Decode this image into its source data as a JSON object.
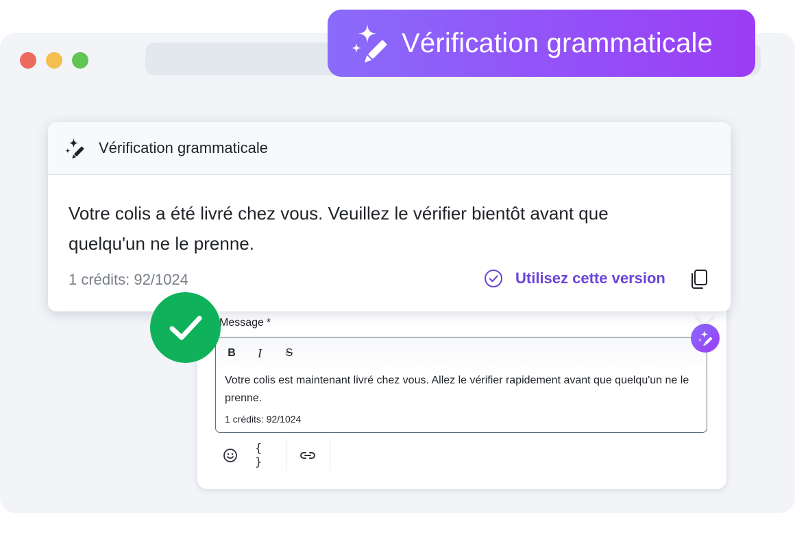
{
  "banner": {
    "title": "Vérification grammaticale",
    "icon": "sparkle-pen-icon"
  },
  "window": {
    "traffic_lights": [
      "#ed6a5e",
      "#f4bf4f",
      "#61c554"
    ]
  },
  "popover": {
    "title": "Vérification grammaticale",
    "corrected_text": "Votre colis a été livré chez vous. Veuillez le vérifier bientôt avant que quelqu'un ne le prenne.",
    "credits": "1 crédits: 92/1024",
    "use_version_label": "Utilisez cette version",
    "icons": [
      "sparkle-pen-icon",
      "check-circle-icon",
      "copy-icon"
    ]
  },
  "editor": {
    "label": "Message",
    "required_mark": "*",
    "format": {
      "bold": "B",
      "italic": "I",
      "strike": "S"
    },
    "text": "Votre colis est maintenant livré chez vous. Allez le vérifier rapidement avant que quelqu'un ne le prenne.",
    "credits": "1 crédits: 92/1024",
    "toolbar": {
      "variables_label": "{ }",
      "icons": [
        "emoji-icon",
        "braces-icon",
        "link-icon"
      ]
    }
  },
  "colors": {
    "accent_purple": "#8a6bfb",
    "accent_violet": "#9b3df5",
    "link_purple": "#6a45d8",
    "success_green": "#0fb25a"
  }
}
